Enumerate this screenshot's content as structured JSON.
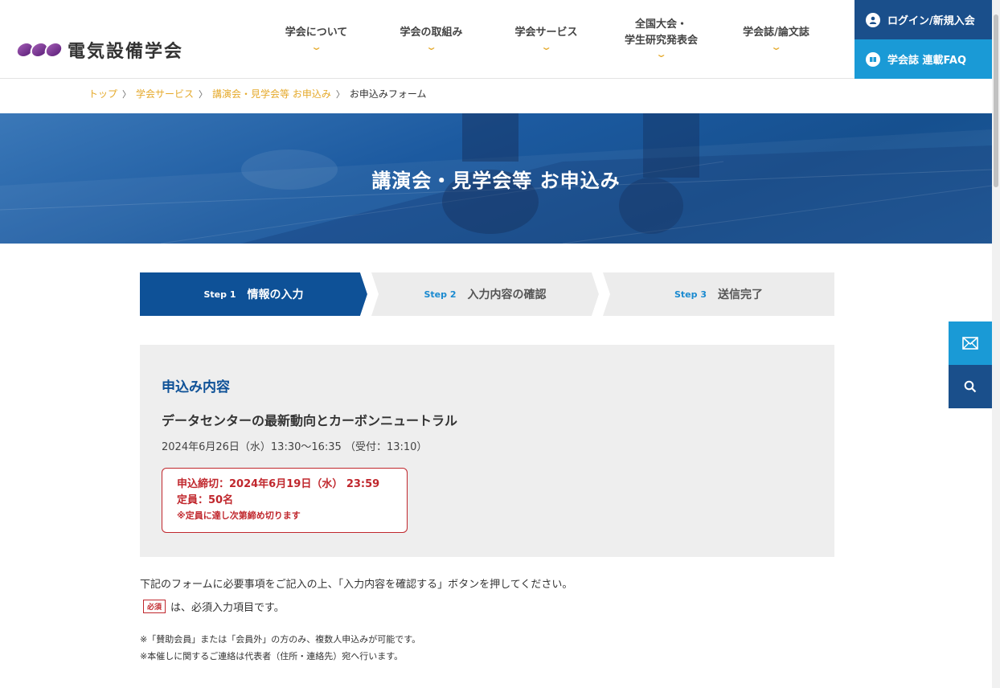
{
  "header": {
    "logo_text": "電気設備学会",
    "nav": [
      {
        "label": "学会について"
      },
      {
        "label": "学会の取組み"
      },
      {
        "label": "学会サービス"
      },
      {
        "label_line1": "全国大会・",
        "label_line2": "学生研究発表会"
      },
      {
        "label": "学会誌/論文誌"
      }
    ],
    "login_label": "ログイン/新規入会",
    "faq_label": "学会誌 連載FAQ"
  },
  "breadcrumb": {
    "items": [
      "トップ",
      "学会サービス",
      "講演会・見学会等 お申込み"
    ],
    "current": "お申込みフォーム"
  },
  "hero": {
    "title": "講演会・見学会等 お申込み"
  },
  "steps": [
    {
      "num": "Step 1",
      "label": "情報の入力",
      "active": true
    },
    {
      "num": "Step 2",
      "label": "入力内容の確認",
      "active": false
    },
    {
      "num": "Step 3",
      "label": "送信完了",
      "active": false
    }
  ],
  "application": {
    "heading": "申込み内容",
    "event_title": "データセンターの最新動向とカーボンニュートラル",
    "event_date": "2024年6月26日（水）13:30〜16:35 （受付：13:10）",
    "deadline": "申込締切：2024年6月19日（水） 23:59",
    "capacity": "定員：50名",
    "capacity_note": "※定員に達し次第締め切ります"
  },
  "instructions": {
    "text": "下記のフォームに必要事項をご記入の上、「入力内容を確認する」ボタンを押してください。",
    "required_badge": "必須",
    "required_text": "は、必須入力項目です。",
    "note1": "※「賛助会員」または「会員外」の方のみ、複数人申込みが可能です。",
    "note2": "※本催しに関するご連絡は代表者（住所・連絡先）宛へ行います。"
  },
  "colors": {
    "primary": "#0e5197",
    "accent_light_blue": "#1a9ad6",
    "link_gold": "#e5a92a",
    "alert_red": "#c0272d"
  }
}
